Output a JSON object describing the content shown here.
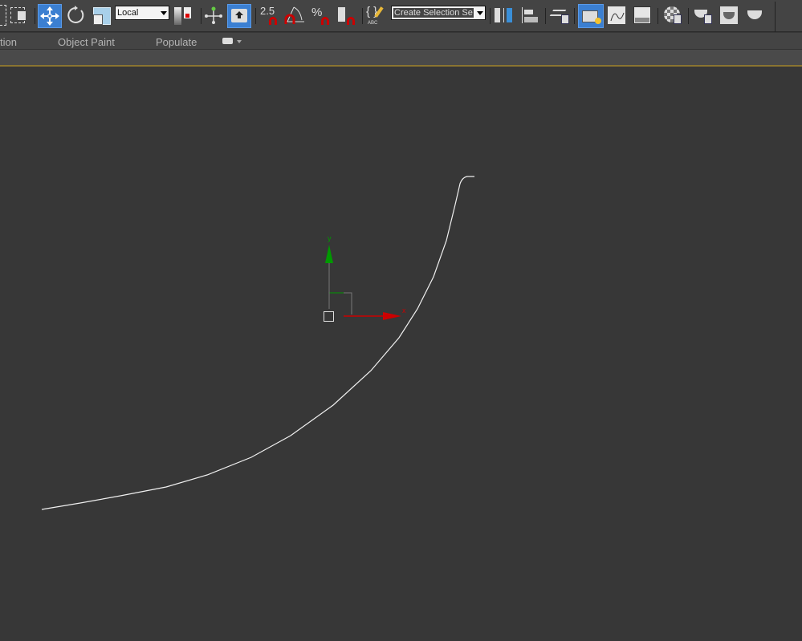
{
  "toolbar": {
    "reference_coord_system": "Local",
    "named_selection_set": "Create Selection Se",
    "snap_spinner_value": "2.5",
    "percent_snap_symbol": "%",
    "edit_named_selection_label": "ABC",
    "accent_color": "#3b7fd1",
    "tools": [
      "select-region-icon",
      "window-crossing-icon",
      "select-move-icon",
      "select-rotate-icon",
      "select-scale-icon",
      "reference-coord-dropdown",
      "pivot-center-icon",
      "manipulate-icon",
      "keyboard-shortcut-override-icon",
      "snaps-toggle-icon",
      "angle-snap-icon",
      "percent-snap-icon",
      "spinner-snap-icon",
      "edit-named-selection-icon",
      "named-selection-dropdown",
      "mirror-icon",
      "align-icon",
      "layer-explorer-icon",
      "scene-explorer-icon",
      "curve-editor-icon",
      "schematic-view-icon",
      "material-editor-icon",
      "render-setup-icon",
      "rendered-frame-window-icon",
      "render-production-icon"
    ]
  },
  "ribbon": {
    "tabs": [
      "tion",
      "Object Paint",
      "Populate"
    ]
  },
  "viewport": {
    "background": "#373737",
    "gizmo": {
      "x_label": "x",
      "y_label": "y",
      "x_color": "#cc0000",
      "y_color": "#009900"
    }
  }
}
